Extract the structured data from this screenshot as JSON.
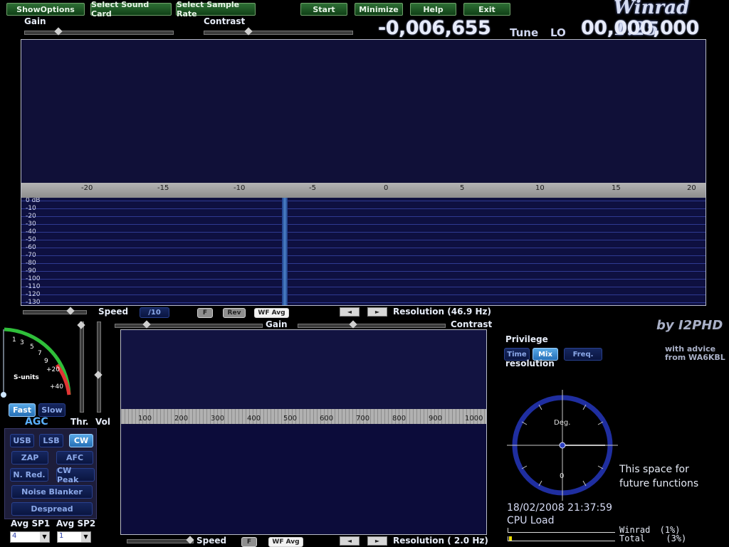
{
  "toolbar": {
    "show_options": "ShowOptions",
    "select_sound_card": "Select Sound Card",
    "select_sample_rate": "Select Sample Rate",
    "start": "Start",
    "minimize": "Minimize",
    "help": "Help",
    "exit": "Exit"
  },
  "app_title": "Winrad 1.25",
  "top_sliders": {
    "gain_label": "Gain",
    "contrast_label": "Contrast"
  },
  "tune": {
    "value": "-0,006,655",
    "label": "Tune"
  },
  "lo": {
    "label": "LO",
    "value": "00,000,000"
  },
  "khz_axis": [
    "-20",
    "-15",
    "-10",
    "-5",
    "0",
    "5",
    "10",
    "15",
    "20"
  ],
  "db_labels": [
    "0  dB",
    "-10",
    "-20",
    "-30",
    "-40",
    "-50",
    "-60",
    "-70",
    "-80",
    "-90",
    "-100",
    "-110",
    "-120",
    "-130"
  ],
  "spectrum_controls": {
    "speed_label": "Speed",
    "div_btn": "/10",
    "f_btn": "F",
    "rev_btn": "Rev",
    "wf_avg_btn": "WF Avg",
    "resolution": "Resolution (46.9 Hz)",
    "left_arrow": "◄",
    "right_arrow": "►"
  },
  "audio_sliders": {
    "gain_label": "Gain",
    "contrast_label": "Contrast"
  },
  "smeter": {
    "scale": [
      "1",
      "3",
      "5",
      "7",
      "9",
      "+20",
      "+40"
    ],
    "units_label": "S-units"
  },
  "agc": {
    "fast": "Fast",
    "slow": "Slow",
    "label": "AGC",
    "thr": "Thr.",
    "vol": "Vol"
  },
  "modes": {
    "usb": "USB",
    "lsb": "LSB",
    "cw": "CW",
    "zap": "ZAP",
    "afc": "AFC",
    "nred": "N. Red.",
    "cwpeak": "CW Peak",
    "noise_blanker": "Noise Blanker",
    "despread": "Despread"
  },
  "avg": {
    "sp1_label": "Avg SP1",
    "sp2_label": "Avg SP2",
    "sp1_value": "4",
    "sp2_value": "1"
  },
  "audio_axis": [
    "100",
    "200",
    "300",
    "400",
    "500",
    "600",
    "700",
    "800",
    "900",
    "1000"
  ],
  "audio_controls": {
    "speed_label": "Speed",
    "f_btn": "F",
    "wf_avg_btn": "WF Avg",
    "resolution": "Resolution ( 2.0 Hz)",
    "left_arrow": "◄",
    "right_arrow": "►"
  },
  "credits": {
    "by": "by I2PHD",
    "advice_1": "with advice",
    "advice_2": "from WA6KBL"
  },
  "privilege": {
    "label": "Privilege",
    "time": "Time",
    "mix": "Mix",
    "freq": "Freq.",
    "resolution_label": "resolution"
  },
  "phase_dial": {
    "deg_label": "Deg.",
    "zero_label": "0"
  },
  "future": {
    "line1": "This space for",
    "line2": "future functions"
  },
  "datetime": "18/02/2008 21:37:59",
  "cpu": {
    "label": "CPU Load",
    "winrad_label": "Winrad",
    "winrad_value": "(1%)",
    "total_label": "Total",
    "total_value": "(3%)"
  },
  "colors": {
    "background": "#000000",
    "panel": "#11123f",
    "accent": "#2e6f35",
    "active": "#3a8fd6"
  }
}
